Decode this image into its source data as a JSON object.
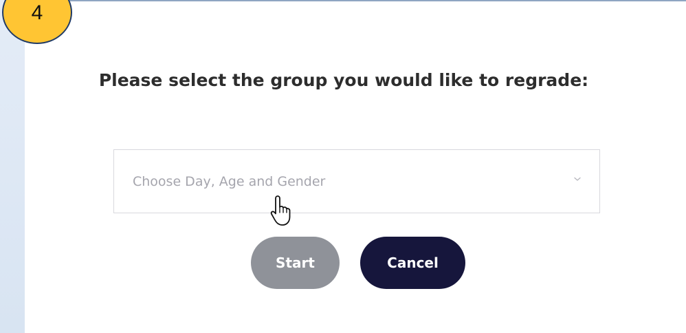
{
  "step_badge": {
    "number": "4",
    "color": "#ffc533"
  },
  "dialog": {
    "prompt": "Please select the group you would like to regrade:",
    "select": {
      "placeholder": "Choose Day, Age and Gender",
      "icon": "chevron-down-icon"
    },
    "buttons": {
      "start_label": "Start",
      "cancel_label": "Cancel"
    }
  },
  "colors": {
    "start_button": "#8f9299",
    "cancel_button": "#16163c",
    "prompt_text": "#2d2d2d",
    "placeholder_text": "#a5a5ad"
  },
  "cursor": {
    "icon": "hand-pointer-icon"
  }
}
